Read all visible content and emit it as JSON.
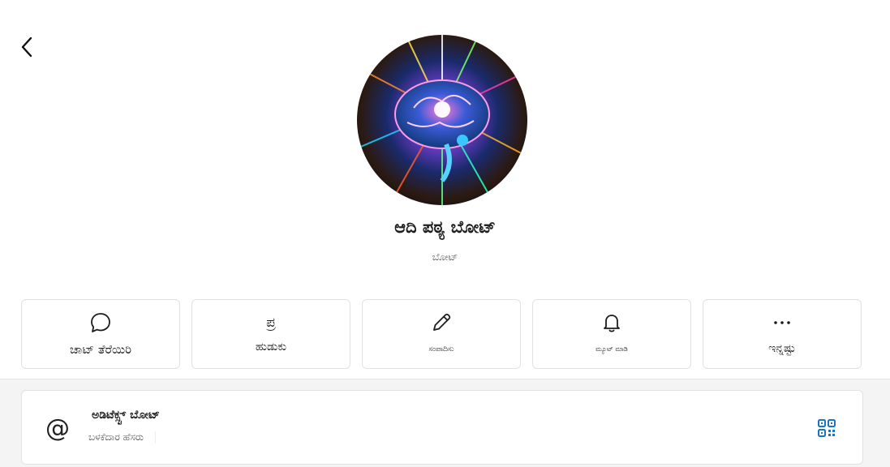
{
  "header": {
    "back_icon": "chevron-left-icon"
  },
  "profile": {
    "avatar": "brain-artwork",
    "name": "ಆದಿ ಪಠ್ಯ ಬೋಟ್",
    "type": "ಬೋಟ್"
  },
  "actions": [
    {
      "icon": "chat-bubble-icon",
      "label": "ಚಾಟ್ ತೆರೆಯಿರಿ"
    },
    {
      "icon": "search-glyph-icon",
      "glyph": "ಪ್ರ",
      "label": "ಹುಡುಕು"
    },
    {
      "icon": "pencil-icon",
      "label": "ಸಂಪಾದಿಸು"
    },
    {
      "icon": "bell-icon",
      "label": "ಮ್ಯೂಟ್ ಮಾಡಿ"
    },
    {
      "icon": "more-dots-icon",
      "label": "ಇನ್ನಷ್ಟು"
    }
  ],
  "username": {
    "icon": "at-icon",
    "value": "ಅಡಿಟೆಕ್ಸ್ಟ್ ಬೋಟ್",
    "label": "ಬಳಕೆದಾರ ಹೆಸರು",
    "qr_icon": "qr-code-icon",
    "accent": "#1a73c7"
  }
}
